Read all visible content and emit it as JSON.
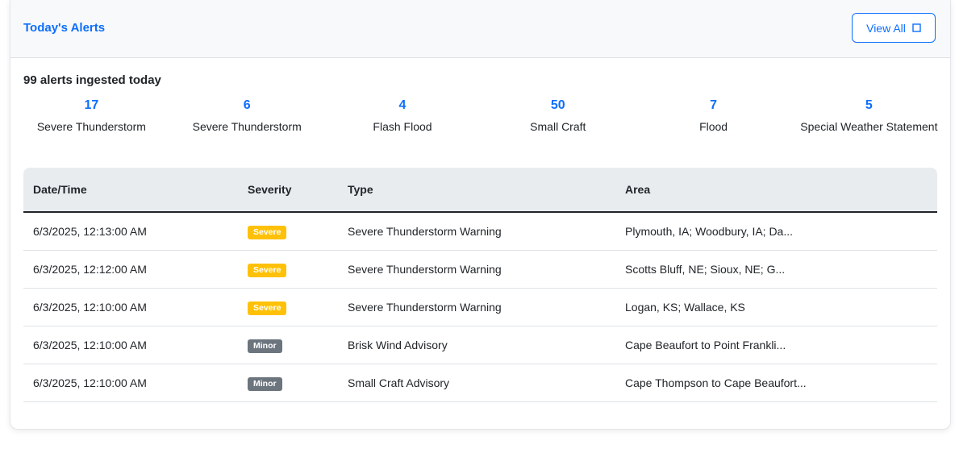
{
  "header": {
    "title": "Today's Alerts",
    "view_all_label": "View All"
  },
  "summary": {
    "title": "99 alerts ingested today",
    "stats": [
      {
        "count": "17",
        "label": "Severe Thunderstorm"
      },
      {
        "count": "6",
        "label": "Severe Thunderstorm"
      },
      {
        "count": "4",
        "label": "Flash Flood"
      },
      {
        "count": "50",
        "label": "Small Craft"
      },
      {
        "count": "7",
        "label": "Flood"
      },
      {
        "count": "5",
        "label": "Special Weather Statement"
      }
    ]
  },
  "table": {
    "columns": [
      "Date/Time",
      "Severity",
      "Type",
      "Area"
    ],
    "rows": [
      {
        "datetime": "6/3/2025, 12:13:00 AM",
        "severity": "Severe",
        "type": "Severe Thunderstorm Warning",
        "area": "Plymouth, IA; Woodbury, IA; Da..."
      },
      {
        "datetime": "6/3/2025, 12:12:00 AM",
        "severity": "Severe",
        "type": "Severe Thunderstorm Warning",
        "area": "Scotts Bluff, NE; Sioux, NE; G..."
      },
      {
        "datetime": "6/3/2025, 12:10:00 AM",
        "severity": "Severe",
        "type": "Severe Thunderstorm Warning",
        "area": "Logan, KS; Wallace, KS"
      },
      {
        "datetime": "6/3/2025, 12:10:00 AM",
        "severity": "Minor",
        "type": "Brisk Wind Advisory",
        "area": "Cape Beaufort to Point Frankli..."
      },
      {
        "datetime": "6/3/2025, 12:10:00 AM",
        "severity": "Minor",
        "type": "Small Craft Advisory",
        "area": "Cape Thompson to Cape Beaufort..."
      }
    ]
  },
  "colors": {
    "accent": "#0d6efd",
    "severe": "#ffc107",
    "minor": "#6c757d"
  },
  "icons": {
    "view_all": "external-link-icon"
  }
}
